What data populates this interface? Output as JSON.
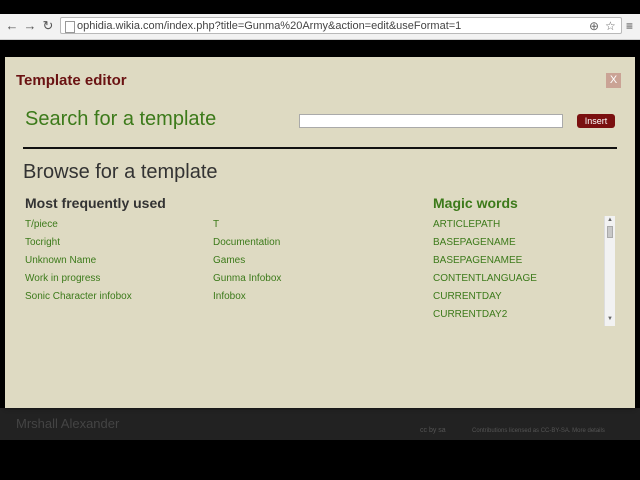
{
  "browser": {
    "url": "ophidia.wikia.com/index.php?title=Gunma%20Army&action=edit&useFormat=1",
    "back_icon": "←",
    "forward_icon": "→",
    "reload_icon": "↻",
    "zoom_icon": "⊕",
    "star_icon": "☆",
    "menu_icon": "≡"
  },
  "background": {
    "footer_name": "Mrshall Alexander",
    "footer_note": "Contributions licensed as CC-BY-SA. More details"
  },
  "modal": {
    "title": "Template editor",
    "close_label": "X",
    "search_heading": "Search for a template",
    "search_value": "",
    "insert_label": "Insert",
    "browse_heading": "Browse for a template",
    "most_frequent_heading": "Most frequently used",
    "magic_words_heading": "Magic words",
    "frequent_col1": [
      "T/piece",
      "Tocright",
      "Unknown Name",
      "Work in progress",
      "Sonic Character infobox"
    ],
    "frequent_col2": [
      "T",
      "Documentation",
      "Games",
      "Gunma Infobox",
      "Infobox"
    ],
    "magic_words": [
      "ARTICLEPATH",
      "BASEPAGENAME",
      "BASEPAGENAMEE",
      "CONTENTLANGUAGE",
      "CURRENTDAY",
      "CURRENTDAY2"
    ]
  },
  "colors": {
    "title": "#6a1212",
    "link_green": "#3c7a1a",
    "modal_bg": "#dedac2",
    "insert_button": "#7a1010"
  }
}
